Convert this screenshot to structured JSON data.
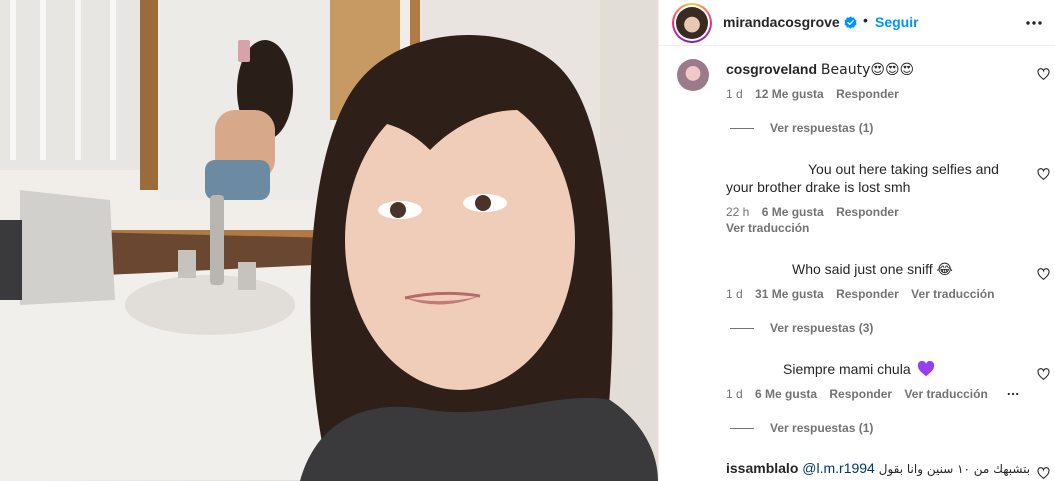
{
  "header": {
    "username": "mirandacosgrove",
    "separator": "•",
    "follow_label": "Seguir",
    "verified_icon": "verified-badge-icon",
    "more_icon": "more-options-icon"
  },
  "colors": {
    "follow": "#0095f6",
    "meta": "#737373",
    "text": "#262626",
    "purple_heart": "#9b3df2"
  },
  "comments": [
    {
      "username": "cosgroveland",
      "text": "Beauty😍😍😍",
      "time": "1 d",
      "likes": "12 Me gusta",
      "reply": "Responder",
      "view_replies": "Ver respuestas (1)"
    },
    {
      "username": "",
      "text_line1": "You out here taking selfies and",
      "text_line2": "your brother drake is lost smh",
      "time": "22 h",
      "likes": "6 Me gusta",
      "reply": "Responder",
      "translate": "Ver traducción"
    },
    {
      "username": "",
      "text": "Who said just one sniff",
      "emoji": "😂",
      "time": "1 d",
      "likes": "31 Me gusta",
      "reply": "Responder",
      "translate": "Ver traducción",
      "view_replies": "Ver respuestas (3)"
    },
    {
      "username": "",
      "text": "Siempre mami chula",
      "time": "1 d",
      "likes": "6 Me gusta",
      "reply": "Responder",
      "translate": "Ver traducción",
      "view_replies": "Ver respuestas (1)"
    },
    {
      "username": "issamblalo",
      "mention": "@l.m.r1994",
      "text": "بتشبهك من ١٠ سنين وانا بقول"
    }
  ]
}
